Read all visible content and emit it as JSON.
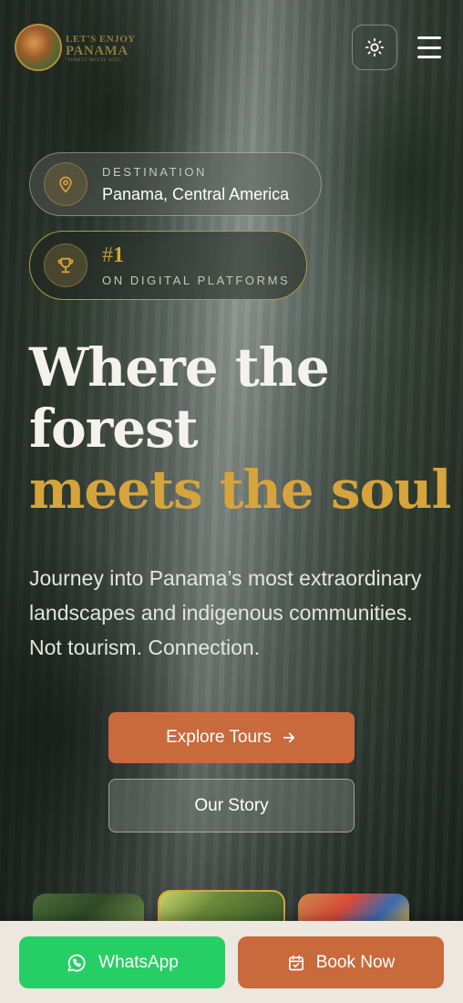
{
  "header": {
    "logo": {
      "line1": "LET'S ENJOY",
      "line2": "PANAMA",
      "line3": "\"FOREST MEETS SOUL\""
    },
    "theme_toggle_icon": "sun-icon",
    "menu_icon": "hamburger-menu-icon"
  },
  "badges": {
    "destination": {
      "icon": "map-pin-icon",
      "caption": "DESTINATION",
      "value": "Panama, Central America"
    },
    "ranking": {
      "icon": "trophy-icon",
      "hash": "#",
      "number": "1",
      "caption": "ON DIGITAL PLATFORMS"
    }
  },
  "hero": {
    "headline_line1": "Where the",
    "headline_line2": "forest",
    "headline_accent": "meets the soul",
    "description": "Journey into Panama’s most extraordinary landscapes and indigenous communities. Not tourism. Connection.",
    "explore_label": "Explore Tours",
    "story_label": "Our Story"
  },
  "bottom_bar": {
    "whatsapp_label": "WhatsApp",
    "book_label": "Book Now"
  },
  "colors": {
    "accent_gold": "#d6a43c",
    "accent_orange": "#c96a3c",
    "whatsapp_green": "#26cf64"
  }
}
